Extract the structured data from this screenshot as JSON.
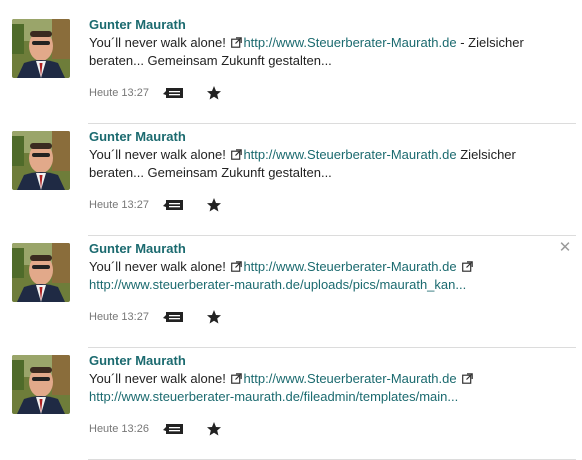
{
  "posts": [
    {
      "author": "Gunter Maurath",
      "text_before": "You´ll never walk alone!",
      "link1": "http://www.Steuerberater-Maurath.de",
      "text_after": " - Zielsicher beraten... Gemeinsam Zukunft gestalten...",
      "link2": "",
      "time": "Heute 13:27"
    },
    {
      "author": "Gunter Maurath",
      "text_before": "You´ll never walk alone!",
      "link1": "http://www.Steuerberater-Maurath.de",
      "text_after": " Zielsicher beraten... Gemeinsam Zukunft gestalten...",
      "link2": "",
      "time": "Heute 13:27"
    },
    {
      "author": "Gunter Maurath",
      "text_before": "You´ll never walk alone!",
      "link1": "http://www.Steuerberater-Maurath.de",
      "text_after": "",
      "link2": "http://www.steuerberater-maurath.de/uploads/pics/maurath_kan...",
      "time": "Heute 13:27"
    },
    {
      "author": "Gunter Maurath",
      "text_before": "You´ll never walk alone!",
      "link1": "http://www.Steuerberater-Maurath.de",
      "text_after": "",
      "link2": "http://www.steuerberater-maurath.de/fileadmin/templates/main...",
      "time": "Heute 13:26"
    }
  ],
  "icons": {
    "external_link": "external-link-icon",
    "comment": "comment-icon",
    "star": "star-icon",
    "close": "close-icon"
  },
  "colors": {
    "link": "#1b6a6f",
    "meta_text": "#777777",
    "divider": "#dcdcdc"
  }
}
